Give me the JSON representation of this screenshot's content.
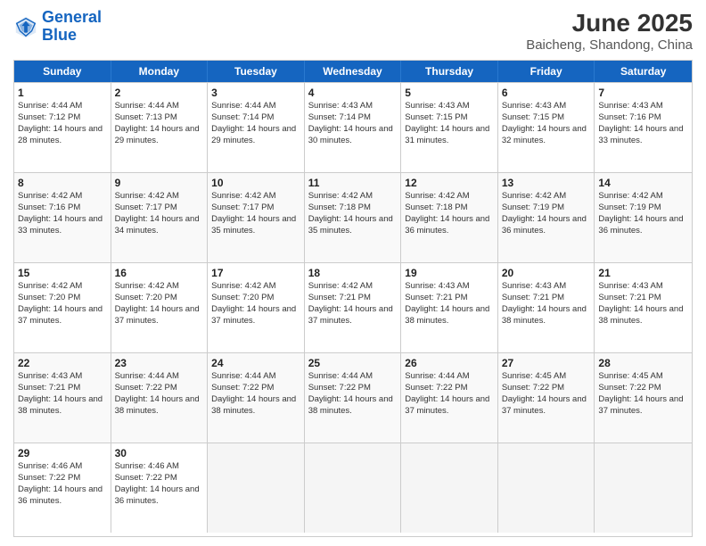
{
  "logo": {
    "line1": "General",
    "line2": "Blue"
  },
  "title": "June 2025",
  "subtitle": "Baicheng, Shandong, China",
  "headers": [
    "Sunday",
    "Monday",
    "Tuesday",
    "Wednesday",
    "Thursday",
    "Friday",
    "Saturday"
  ],
  "rows": [
    [
      {
        "day": "1",
        "sunrise": "Sunrise: 4:44 AM",
        "sunset": "Sunset: 7:12 PM",
        "daylight": "Daylight: 14 hours and 28 minutes."
      },
      {
        "day": "2",
        "sunrise": "Sunrise: 4:44 AM",
        "sunset": "Sunset: 7:13 PM",
        "daylight": "Daylight: 14 hours and 29 minutes."
      },
      {
        "day": "3",
        "sunrise": "Sunrise: 4:44 AM",
        "sunset": "Sunset: 7:14 PM",
        "daylight": "Daylight: 14 hours and 29 minutes."
      },
      {
        "day": "4",
        "sunrise": "Sunrise: 4:43 AM",
        "sunset": "Sunset: 7:14 PM",
        "daylight": "Daylight: 14 hours and 30 minutes."
      },
      {
        "day": "5",
        "sunrise": "Sunrise: 4:43 AM",
        "sunset": "Sunset: 7:15 PM",
        "daylight": "Daylight: 14 hours and 31 minutes."
      },
      {
        "day": "6",
        "sunrise": "Sunrise: 4:43 AM",
        "sunset": "Sunset: 7:15 PM",
        "daylight": "Daylight: 14 hours and 32 minutes."
      },
      {
        "day": "7",
        "sunrise": "Sunrise: 4:43 AM",
        "sunset": "Sunset: 7:16 PM",
        "daylight": "Daylight: 14 hours and 33 minutes."
      }
    ],
    [
      {
        "day": "8",
        "sunrise": "Sunrise: 4:42 AM",
        "sunset": "Sunset: 7:16 PM",
        "daylight": "Daylight: 14 hours and 33 minutes."
      },
      {
        "day": "9",
        "sunrise": "Sunrise: 4:42 AM",
        "sunset": "Sunset: 7:17 PM",
        "daylight": "Daylight: 14 hours and 34 minutes."
      },
      {
        "day": "10",
        "sunrise": "Sunrise: 4:42 AM",
        "sunset": "Sunset: 7:17 PM",
        "daylight": "Daylight: 14 hours and 35 minutes."
      },
      {
        "day": "11",
        "sunrise": "Sunrise: 4:42 AM",
        "sunset": "Sunset: 7:18 PM",
        "daylight": "Daylight: 14 hours and 35 minutes."
      },
      {
        "day": "12",
        "sunrise": "Sunrise: 4:42 AM",
        "sunset": "Sunset: 7:18 PM",
        "daylight": "Daylight: 14 hours and 36 minutes."
      },
      {
        "day": "13",
        "sunrise": "Sunrise: 4:42 AM",
        "sunset": "Sunset: 7:19 PM",
        "daylight": "Daylight: 14 hours and 36 minutes."
      },
      {
        "day": "14",
        "sunrise": "Sunrise: 4:42 AM",
        "sunset": "Sunset: 7:19 PM",
        "daylight": "Daylight: 14 hours and 36 minutes."
      }
    ],
    [
      {
        "day": "15",
        "sunrise": "Sunrise: 4:42 AM",
        "sunset": "Sunset: 7:20 PM",
        "daylight": "Daylight: 14 hours and 37 minutes."
      },
      {
        "day": "16",
        "sunrise": "Sunrise: 4:42 AM",
        "sunset": "Sunset: 7:20 PM",
        "daylight": "Daylight: 14 hours and 37 minutes."
      },
      {
        "day": "17",
        "sunrise": "Sunrise: 4:42 AM",
        "sunset": "Sunset: 7:20 PM",
        "daylight": "Daylight: 14 hours and 37 minutes."
      },
      {
        "day": "18",
        "sunrise": "Sunrise: 4:42 AM",
        "sunset": "Sunset: 7:21 PM",
        "daylight": "Daylight: 14 hours and 37 minutes."
      },
      {
        "day": "19",
        "sunrise": "Sunrise: 4:43 AM",
        "sunset": "Sunset: 7:21 PM",
        "daylight": "Daylight: 14 hours and 38 minutes."
      },
      {
        "day": "20",
        "sunrise": "Sunrise: 4:43 AM",
        "sunset": "Sunset: 7:21 PM",
        "daylight": "Daylight: 14 hours and 38 minutes."
      },
      {
        "day": "21",
        "sunrise": "Sunrise: 4:43 AM",
        "sunset": "Sunset: 7:21 PM",
        "daylight": "Daylight: 14 hours and 38 minutes."
      }
    ],
    [
      {
        "day": "22",
        "sunrise": "Sunrise: 4:43 AM",
        "sunset": "Sunset: 7:21 PM",
        "daylight": "Daylight: 14 hours and 38 minutes."
      },
      {
        "day": "23",
        "sunrise": "Sunrise: 4:44 AM",
        "sunset": "Sunset: 7:22 PM",
        "daylight": "Daylight: 14 hours and 38 minutes."
      },
      {
        "day": "24",
        "sunrise": "Sunrise: 4:44 AM",
        "sunset": "Sunset: 7:22 PM",
        "daylight": "Daylight: 14 hours and 38 minutes."
      },
      {
        "day": "25",
        "sunrise": "Sunrise: 4:44 AM",
        "sunset": "Sunset: 7:22 PM",
        "daylight": "Daylight: 14 hours and 38 minutes."
      },
      {
        "day": "26",
        "sunrise": "Sunrise: 4:44 AM",
        "sunset": "Sunset: 7:22 PM",
        "daylight": "Daylight: 14 hours and 37 minutes."
      },
      {
        "day": "27",
        "sunrise": "Sunrise: 4:45 AM",
        "sunset": "Sunset: 7:22 PM",
        "daylight": "Daylight: 14 hours and 37 minutes."
      },
      {
        "day": "28",
        "sunrise": "Sunrise: 4:45 AM",
        "sunset": "Sunset: 7:22 PM",
        "daylight": "Daylight: 14 hours and 37 minutes."
      }
    ],
    [
      {
        "day": "29",
        "sunrise": "Sunrise: 4:46 AM",
        "sunset": "Sunset: 7:22 PM",
        "daylight": "Daylight: 14 hours and 36 minutes."
      },
      {
        "day": "30",
        "sunrise": "Sunrise: 4:46 AM",
        "sunset": "Sunset: 7:22 PM",
        "daylight": "Daylight: 14 hours and 36 minutes."
      },
      {
        "day": "",
        "sunrise": "",
        "sunset": "",
        "daylight": ""
      },
      {
        "day": "",
        "sunrise": "",
        "sunset": "",
        "daylight": ""
      },
      {
        "day": "",
        "sunrise": "",
        "sunset": "",
        "daylight": ""
      },
      {
        "day": "",
        "sunrise": "",
        "sunset": "",
        "daylight": ""
      },
      {
        "day": "",
        "sunrise": "",
        "sunset": "",
        "daylight": ""
      }
    ]
  ]
}
